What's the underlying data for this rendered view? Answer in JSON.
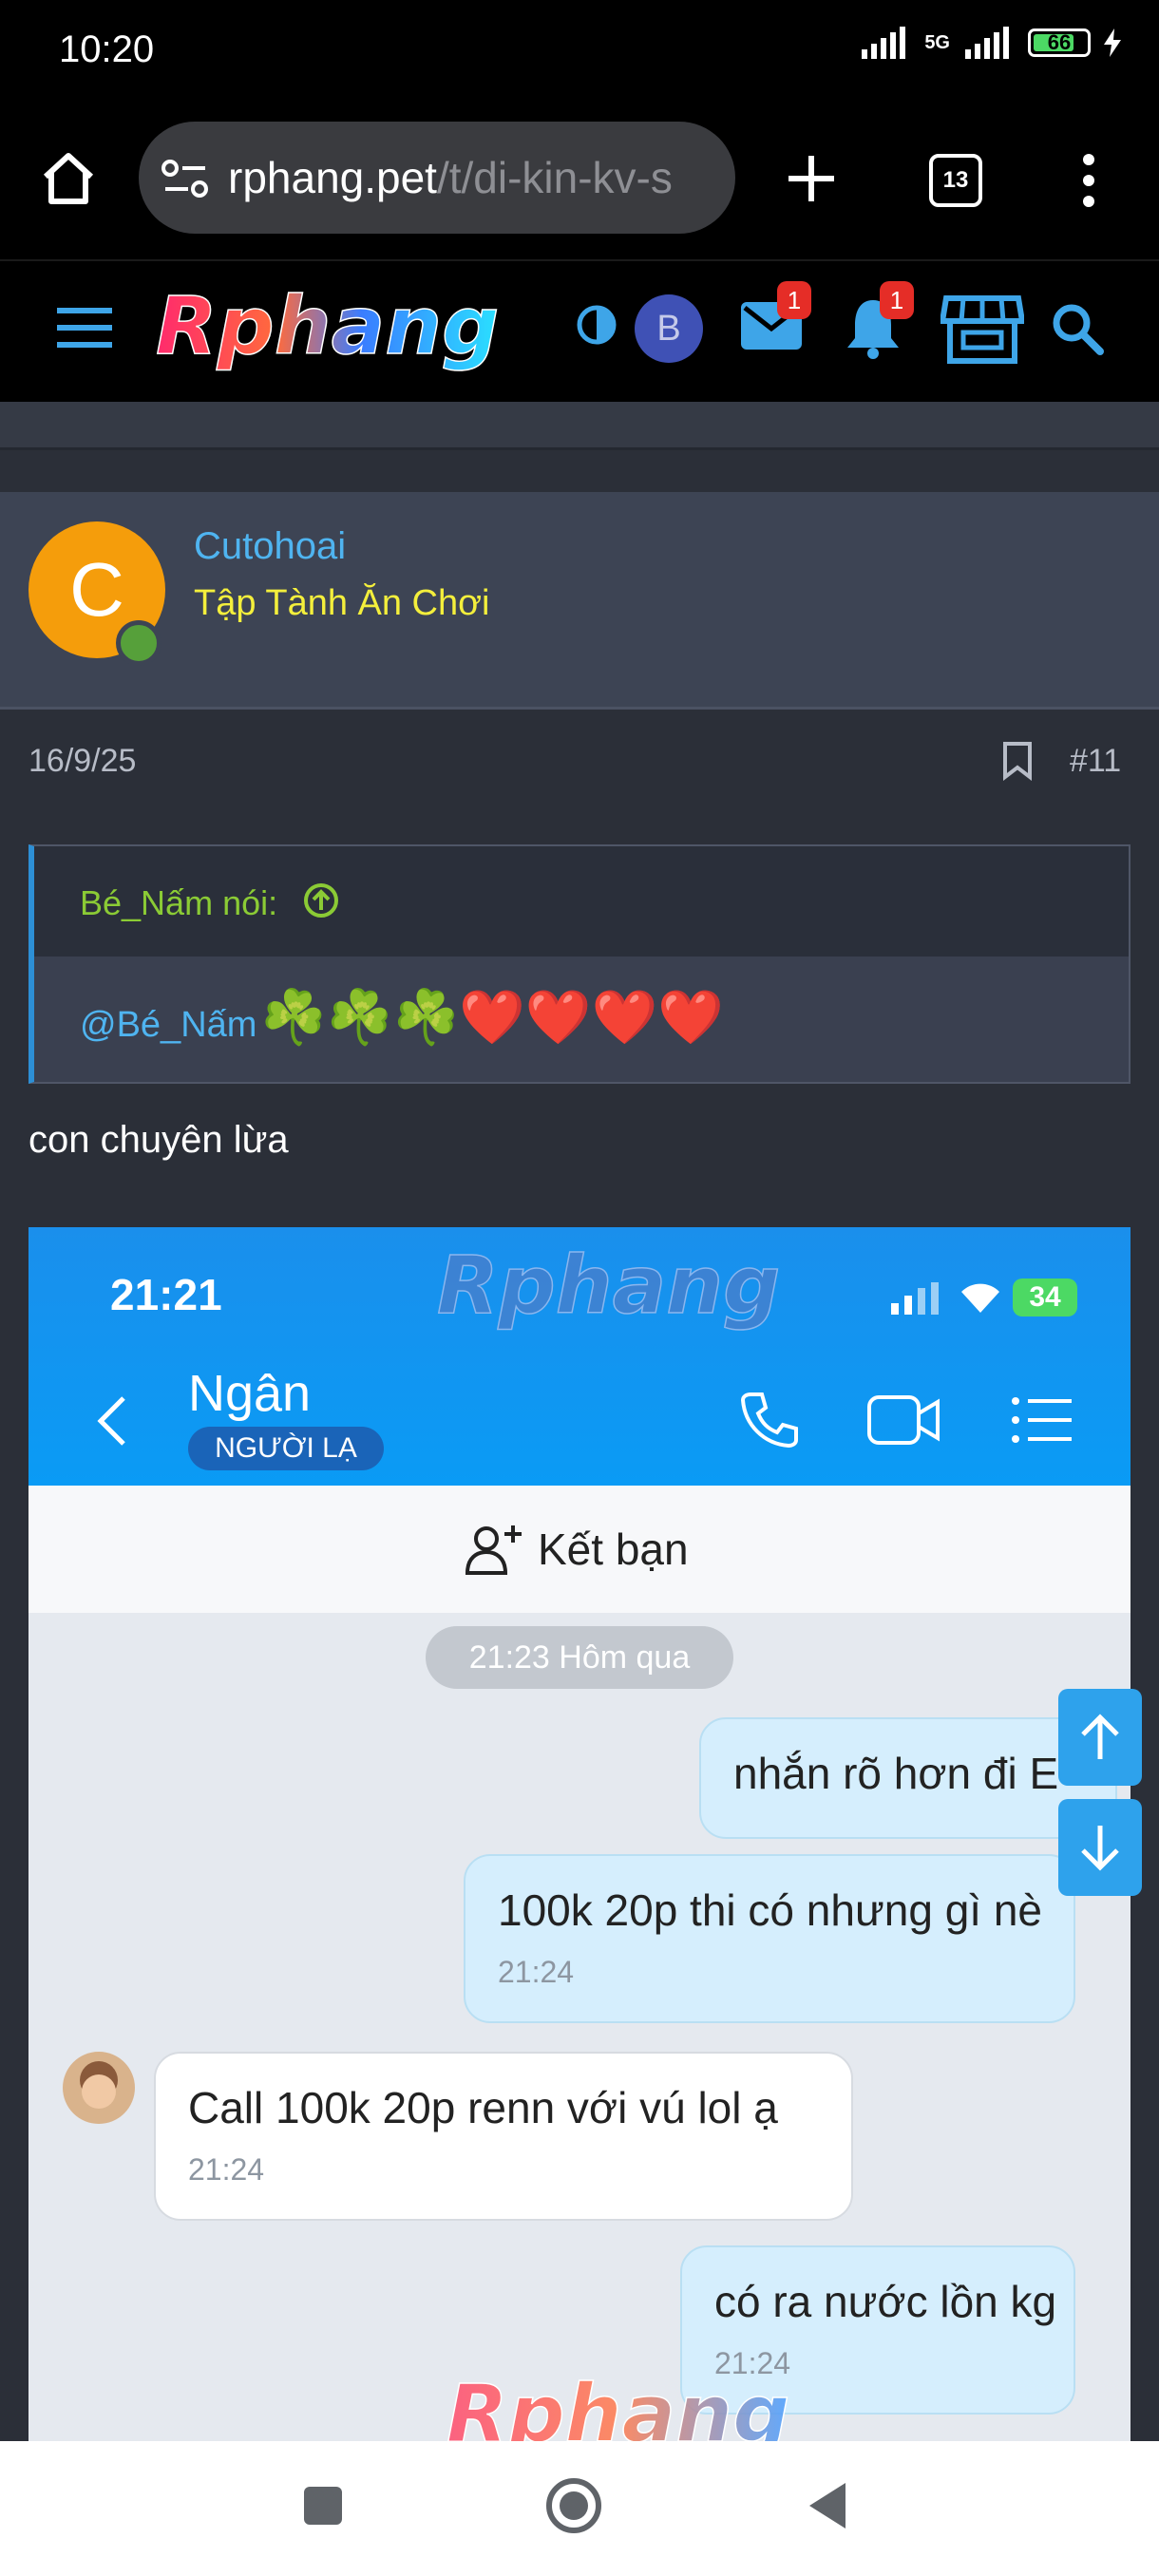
{
  "status_bar": {
    "time": "10:20",
    "network": "5G",
    "battery": "66"
  },
  "browser": {
    "url_host": "rphang.pet",
    "url_path": "/t/di-kin-kv-s",
    "tab_count": "13"
  },
  "site_header": {
    "logo": "Rphang",
    "avatar_letter": "B",
    "inbox_badge": "1",
    "alerts_badge": "1"
  },
  "post": {
    "author_initial": "C",
    "author": "Cutohoai",
    "author_title": "Tập Tành Ăn Chơi",
    "date": "16/9/25",
    "post_number": "#11",
    "quote": {
      "by": "Bé_Nấm nói:",
      "mention": "@Bé_Nấm",
      "emojis": "☘️☘️☘️❤️❤️❤️❤️"
    },
    "body": "con chuyên lừa"
  },
  "embedded_screenshot": {
    "status_time": "21:21",
    "battery": "34",
    "watermark": "Rphang",
    "contact_name": "Ngân",
    "contact_tag": "NGƯỜI LẠ",
    "add_friend_label": "Kết bạn",
    "date_separator": "21:23 Hôm qua",
    "messages": [
      {
        "from": "me",
        "text": "nhắn rõ hơn đi E",
        "time": ""
      },
      {
        "from": "me",
        "text": "100k 20p thi có nhưng gì nè",
        "time": "21:24"
      },
      {
        "from": "them",
        "text": "Call 100k 20p renn với vú lol ạ",
        "time": "21:24"
      },
      {
        "from": "me",
        "text": "có ra nước lồn kg",
        "time": "21:24"
      }
    ]
  },
  "colors": {
    "site_bg": "#2b2f38",
    "link_blue": "#4fb4f0",
    "title_yellow": "#f4ef3c",
    "quote_green": "#8bcb35",
    "chat_header_blue": "#0a9bf5"
  }
}
